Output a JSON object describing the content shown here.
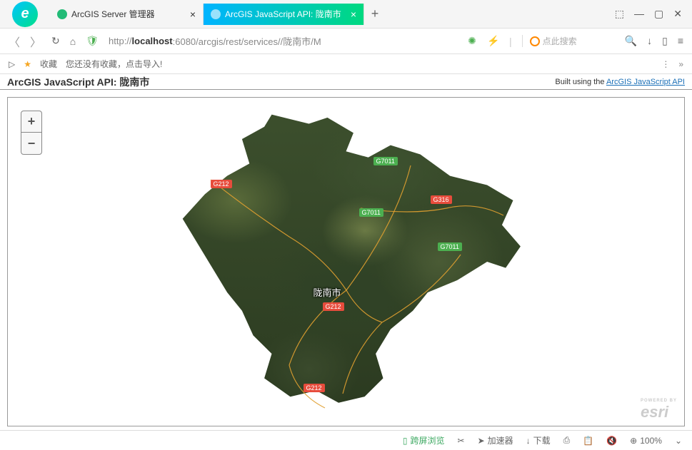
{
  "tabs": {
    "inactive": {
      "title": "ArcGIS Server 管理器"
    },
    "active": {
      "title": "ArcGIS JavaScript API: 陇南市"
    }
  },
  "url": {
    "prefix": "http://",
    "host": "localhost",
    "path": ":6080/arcgis/rest/services//陇南市/M"
  },
  "search": {
    "placeholder": "点此搜索"
  },
  "bookmarks": {
    "fav_label": "收藏",
    "empty_hint": "您还没有收藏，点击导入!"
  },
  "page": {
    "title": "ArcGIS JavaScript API: 陇南市",
    "built_prefix": "Built using the ",
    "built_link": "ArcGIS JavaScript API"
  },
  "map": {
    "city": "陇南市",
    "routes": {
      "g7011_top": "G7011",
      "g7011_mid": "G7011",
      "g7011_right": "G7011",
      "g212_nw": "G212",
      "g212_center": "G212",
      "g212_south": "G212",
      "g316": "G316"
    },
    "esri_small": "POWERED BY",
    "esri_text": "esri"
  },
  "status": {
    "cross_screen": "跨屏浏览",
    "accelerator": "加速器",
    "download": "下载",
    "zoom": "100%"
  }
}
